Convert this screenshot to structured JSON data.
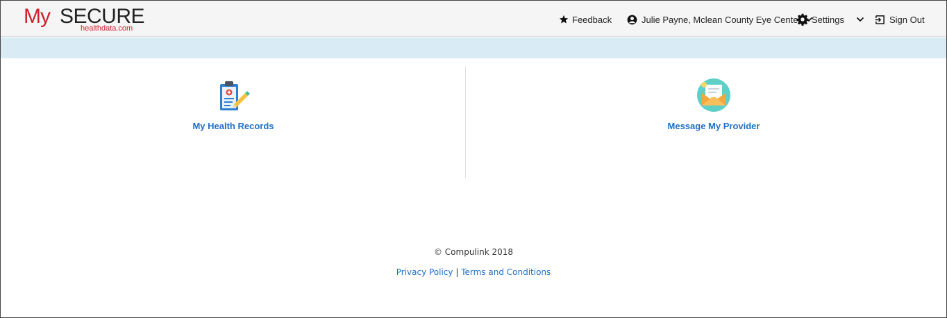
{
  "logo": {
    "my": "My",
    "secure": "SECURE",
    "sub": "healthdata.com"
  },
  "nav": {
    "feedback": "Feedback",
    "user": "Julie Payne, Mclean County Eye Center",
    "settings": "Settings",
    "signout": "Sign Out"
  },
  "tiles": {
    "records": "My Health Records",
    "message": "Message My Provider"
  },
  "footer": {
    "copyright": "© Compulink 2018",
    "privacy": "Privacy Policy",
    "separator": "|",
    "terms": "Terms and Conditions"
  },
  "colors": {
    "brand_red": "#d0202c",
    "link_blue": "#1f6fc7",
    "banner": "#d9ebf5"
  },
  "icons": [
    "star-icon",
    "user-circle-icon",
    "chevron-down-icon",
    "gear-icon",
    "sign-out-icon",
    "clipboard-pencil-icon",
    "envelope-icon"
  ]
}
